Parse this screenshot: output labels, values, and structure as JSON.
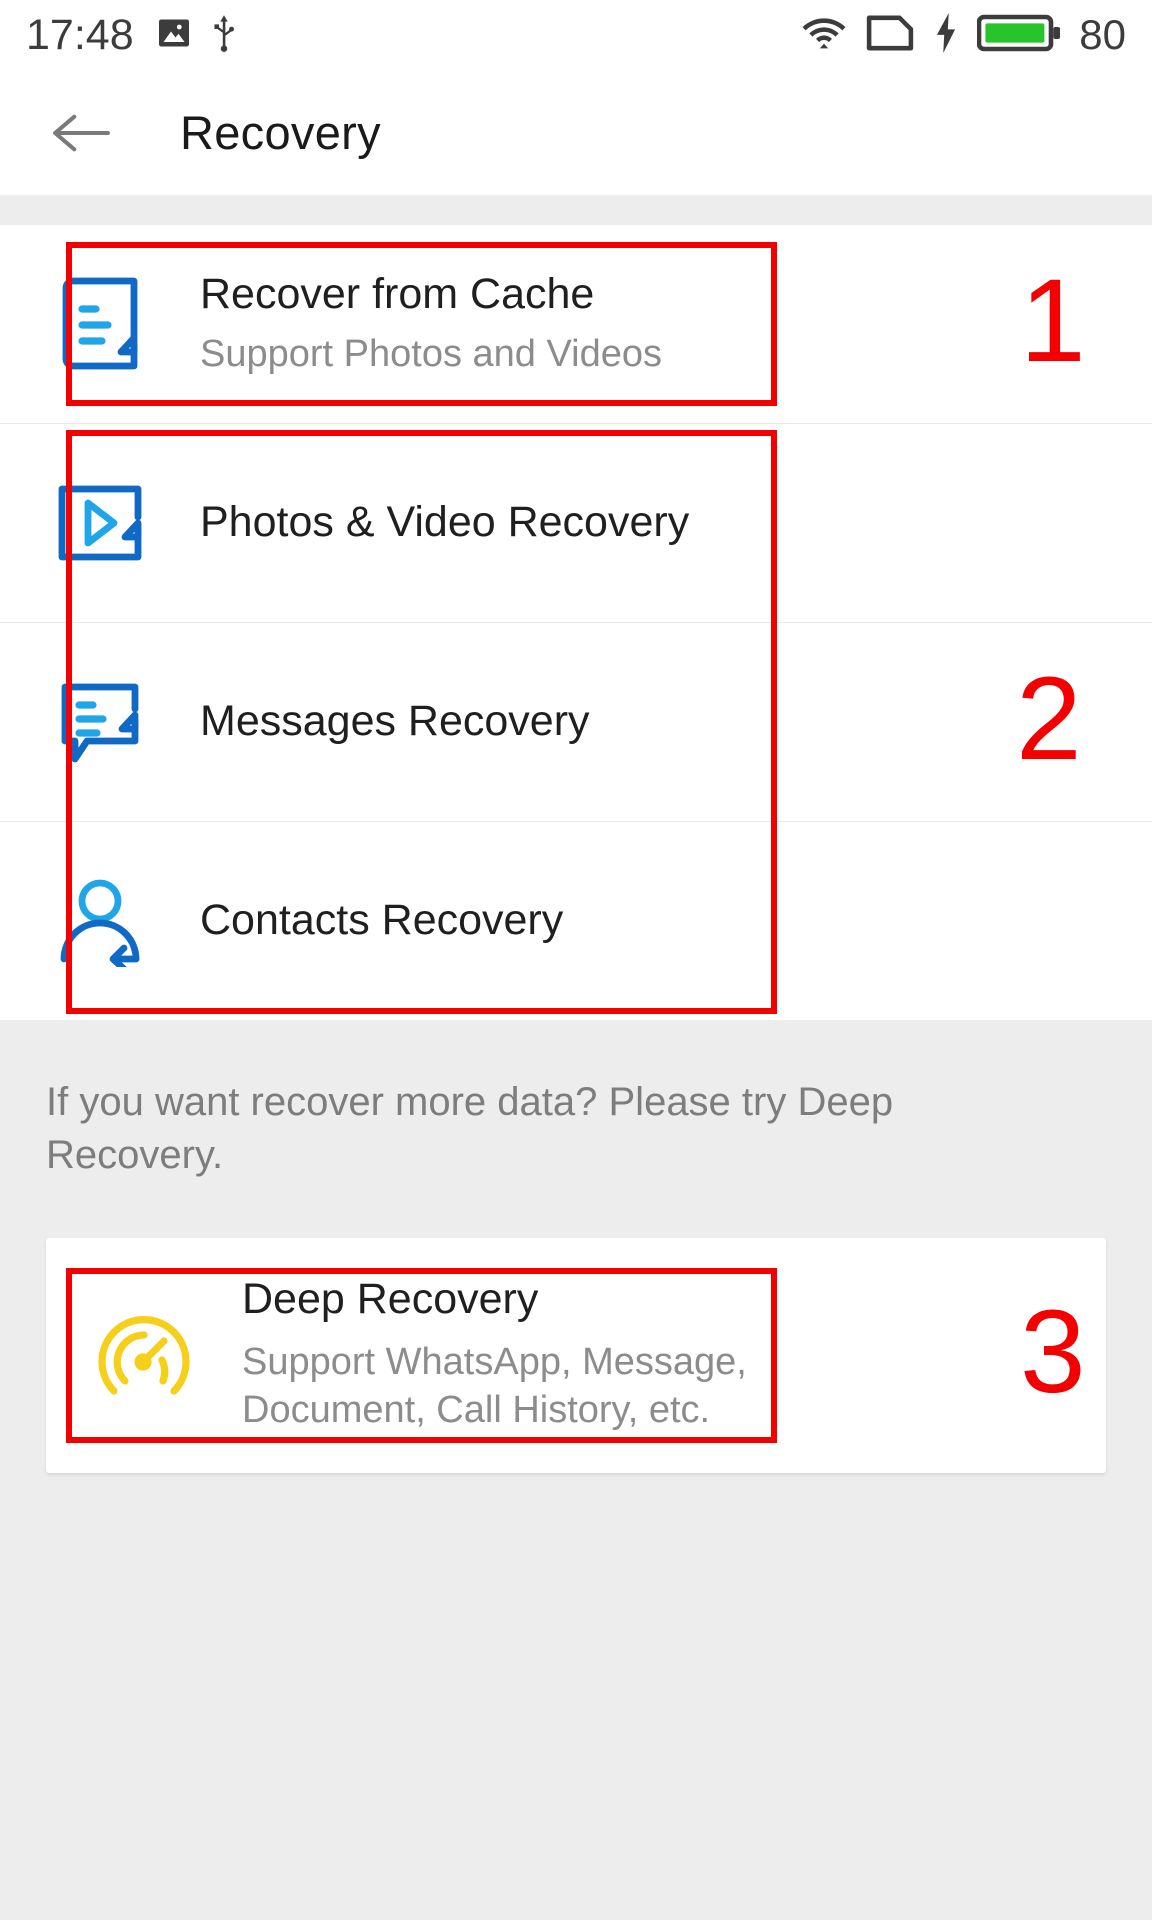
{
  "statusbar": {
    "time": "17:48",
    "icons": [
      "image-icon",
      "usb-icon",
      "wifi-icon",
      "sim-card-icon",
      "charging-bolt-icon",
      "battery-icon"
    ],
    "battery_level": "80",
    "battery_color": "#27c52b",
    "icon_color": "#3c3c3c"
  },
  "appbar": {
    "back_label": "back-arrow",
    "title": "Recovery"
  },
  "main": {
    "group_one": [
      {
        "icon": "document-lines-icon",
        "title": "Recover from Cache",
        "subtitle": "Support Photos and Videos"
      }
    ],
    "group_two": [
      {
        "icon": "video-play-icon",
        "title": "Photos & Video Recovery",
        "subtitle": ""
      },
      {
        "icon": "message-bubble-icon",
        "title": "Messages Recovery",
        "subtitle": ""
      },
      {
        "icon": "contact-person-icon",
        "title": "Contacts Recovery",
        "subtitle": ""
      }
    ],
    "hint": "If you want recover more data? Please try Deep Recovery.",
    "deep": {
      "icon": "speedometer-icon",
      "title": "Deep Recovery",
      "subtitle": "Support WhatsApp, Message, Document, Call History, etc."
    }
  },
  "annotations": {
    "numbers": [
      "1",
      "2",
      "3"
    ],
    "color": "#f40000"
  },
  "colors": {
    "icon_blue_dark": "#1069c4",
    "icon_blue_light": "#20a6e8",
    "icon_yellow": "#f5cf1a",
    "page_bg": "#ededed",
    "card_bg": "#ffffff",
    "title_text": "#1f1f1f",
    "sub_text": "#8c8c8c"
  }
}
